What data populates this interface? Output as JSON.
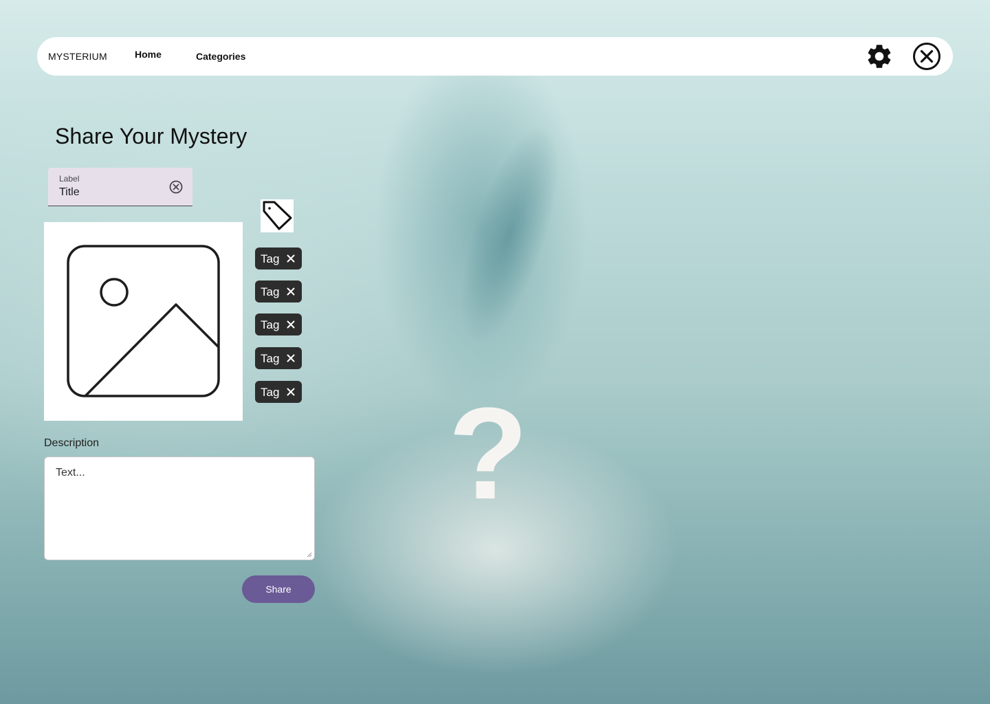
{
  "nav": {
    "brand": "MYSTERIUM",
    "home": "Home",
    "categories": "Categories",
    "settings_icon": "gear-icon",
    "close_icon": "close-circle-icon"
  },
  "page": {
    "title": "Share Your Mystery"
  },
  "title_field": {
    "label": "Label",
    "value": "Title",
    "clear_icon": "clear-circle-icon"
  },
  "image_placeholder_icon": "image-icon",
  "tag_icon": "tag-icon",
  "tags": [
    {
      "label": "Tag"
    },
    {
      "label": "Tag"
    },
    {
      "label": "Tag"
    },
    {
      "label": "Tag"
    },
    {
      "label": "Tag"
    }
  ],
  "description": {
    "label": "Description",
    "placeholder": "Text..."
  },
  "share_button": "Share",
  "background_symbol": "?",
  "colors": {
    "primary": "#6a5a96",
    "chip": "#2d2d2d",
    "field_bg": "#e7e0ea"
  }
}
